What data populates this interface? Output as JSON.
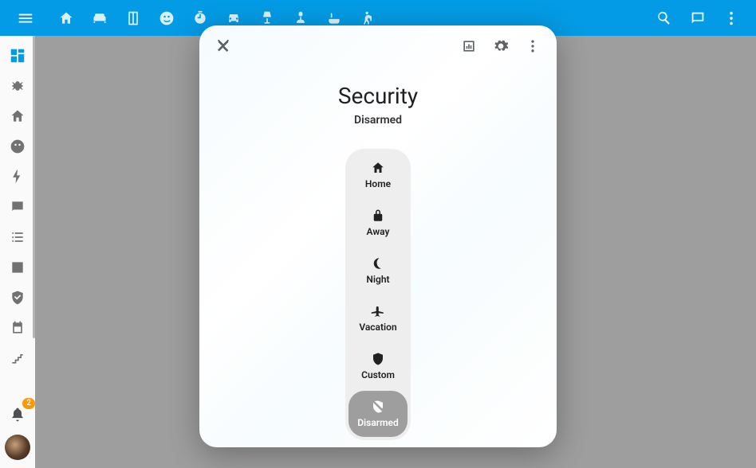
{
  "dialog": {
    "title": "Security",
    "subtitle": "Disarmed",
    "modes": [
      {
        "key": "home",
        "label": "Home"
      },
      {
        "key": "away",
        "label": "Away"
      },
      {
        "key": "night",
        "label": "Night"
      },
      {
        "key": "vacation",
        "label": "Vacation"
      },
      {
        "key": "custom",
        "label": "Custom"
      },
      {
        "key": "disarmed",
        "label": "Disarmed"
      }
    ],
    "selected": "disarmed"
  },
  "notifications": {
    "count": "2"
  }
}
